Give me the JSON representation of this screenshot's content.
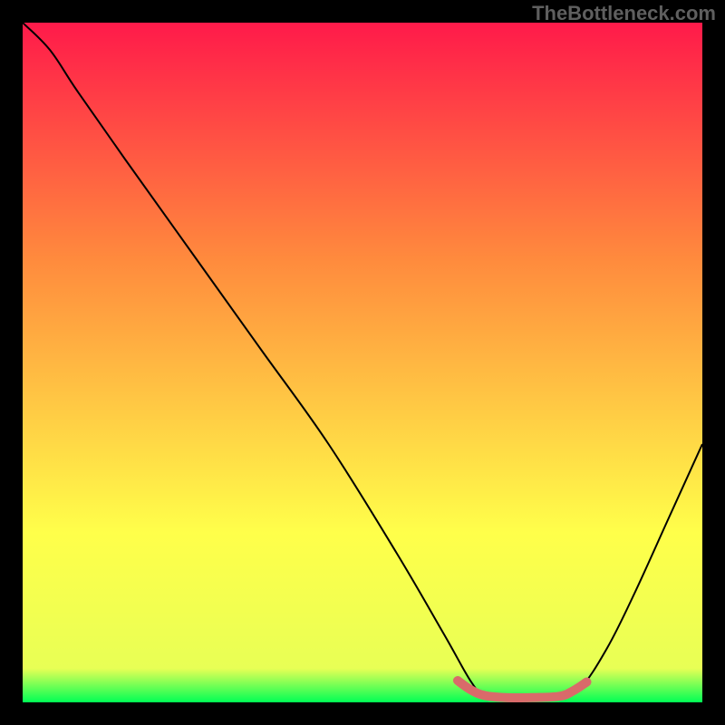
{
  "watermark": "TheBottleneck.com",
  "chart_data": {
    "type": "line",
    "title": "",
    "xlabel": "",
    "ylabel": "",
    "xlim": [
      0,
      100
    ],
    "ylim": [
      0,
      100
    ],
    "background_gradient": {
      "top": "#ff1a4a",
      "mid_upper": "#ff8b3d",
      "mid_lower": "#ffff4a",
      "bottom": "#00ff55"
    },
    "series": [
      {
        "name": "curve",
        "color": "#000000",
        "stroke_width": 2,
        "points": [
          {
            "x": 0,
            "y": 100
          },
          {
            "x": 4,
            "y": 96
          },
          {
            "x": 8,
            "y": 90
          },
          {
            "x": 15,
            "y": 80
          },
          {
            "x": 25,
            "y": 66
          },
          {
            "x": 35,
            "y": 52
          },
          {
            "x": 45,
            "y": 38
          },
          {
            "x": 55,
            "y": 22
          },
          {
            "x": 62,
            "y": 10
          },
          {
            "x": 66,
            "y": 3
          },
          {
            "x": 68,
            "y": 1
          },
          {
            "x": 71,
            "y": 0.5
          },
          {
            "x": 75,
            "y": 0.5
          },
          {
            "x": 79,
            "y": 0.7
          },
          {
            "x": 82,
            "y": 2
          },
          {
            "x": 86,
            "y": 8
          },
          {
            "x": 90,
            "y": 16
          },
          {
            "x": 95,
            "y": 27
          },
          {
            "x": 100,
            "y": 38
          }
        ]
      },
      {
        "name": "highlight-band",
        "color": "#d96a6a",
        "stroke_width": 10,
        "points": [
          {
            "x": 64,
            "y": 3.2
          },
          {
            "x": 66,
            "y": 1.8
          },
          {
            "x": 68,
            "y": 1.0
          },
          {
            "x": 71,
            "y": 0.7
          },
          {
            "x": 75,
            "y": 0.7
          },
          {
            "x": 79,
            "y": 0.9
          },
          {
            "x": 81,
            "y": 1.7
          },
          {
            "x": 83,
            "y": 3.0
          }
        ]
      }
    ]
  }
}
